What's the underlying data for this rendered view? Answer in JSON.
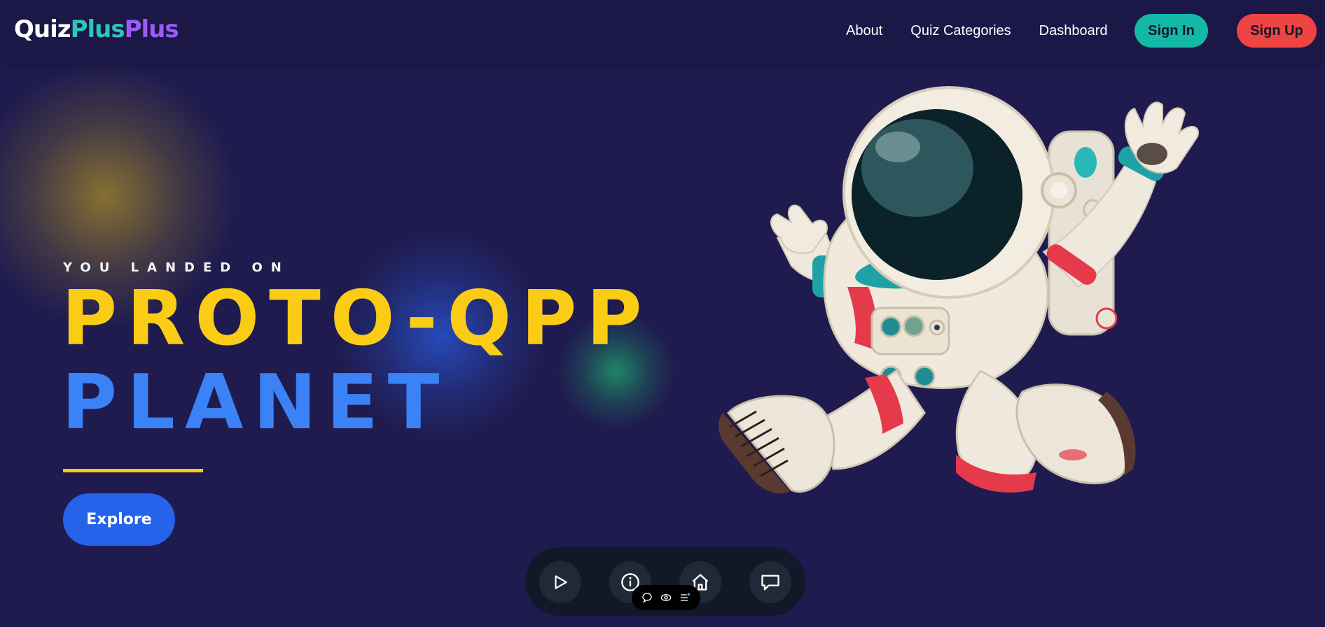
{
  "header": {
    "logo": {
      "part1": "Quiz",
      "part2": "Plus",
      "part3": "Plus"
    },
    "nav": [
      {
        "label": "About"
      },
      {
        "label": "Quiz Categories"
      },
      {
        "label": "Dashboard"
      }
    ],
    "sign_in_label": "Sign In",
    "sign_up_label": "Sign Up"
  },
  "hero": {
    "eyebrow": "YOU LANDED ON",
    "title_line1": "PROTO-QPP",
    "title_line2": "PLANET",
    "explore_label": "Explore"
  },
  "dock": {
    "icons": [
      "play-icon",
      "info-icon",
      "home-icon",
      "chat-icon"
    ]
  },
  "mini_toolbar": {
    "icons": [
      "comment-icon",
      "eye-icon",
      "list-settings-icon"
    ]
  },
  "colors": {
    "background": "#1f1b4f",
    "title_yellow": "#facc15",
    "title_blue": "#3b82f6",
    "sign_in": "#14b8a6",
    "sign_up": "#ef4444",
    "explore": "#2563eb",
    "logo_teal": "#2ec4b6",
    "logo_purple": "#9b5cf5"
  }
}
